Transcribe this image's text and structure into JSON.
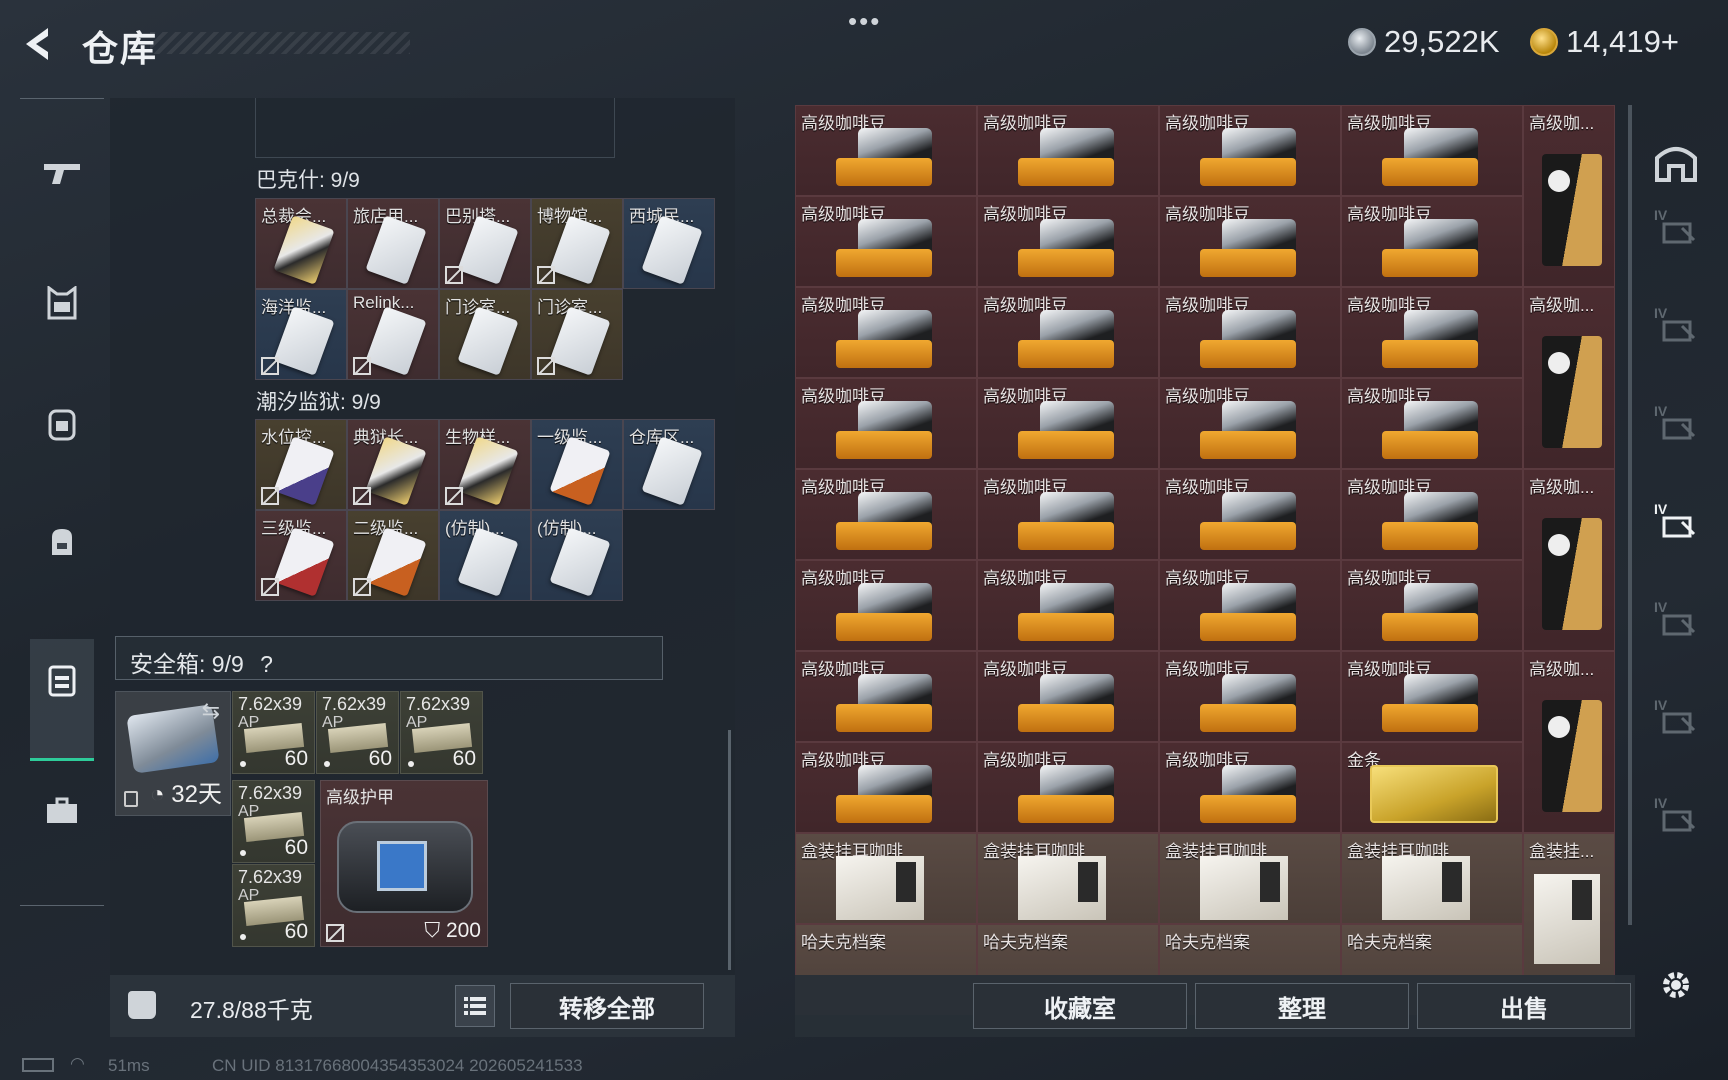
{
  "header": {
    "title": "仓库",
    "menu_dots": "•••",
    "currency_silver": "29,522K",
    "currency_gold": "14,419+",
    "colors": {
      "accent_green": "#2ecc9a",
      "item_red": "#4b2c30"
    }
  },
  "left_sidebar": {
    "icons": [
      "gun-icon",
      "armor-vest-icon",
      "backpack-icon",
      "bag-icon",
      "container-icon",
      "briefcase-icon"
    ],
    "active_index": 4
  },
  "keycards": {
    "groups": [
      {
        "title": "巴克什: 9/9",
        "cards": [
          {
            "label": "总裁会...",
            "style": "goldc",
            "color": "red",
            "bound": false
          },
          {
            "label": "旅店用...",
            "style": "",
            "color": "red",
            "bound": false
          },
          {
            "label": "巴别塔...",
            "style": "",
            "color": "red",
            "bound": true
          },
          {
            "label": "博物馆...",
            "style": "",
            "color": "gold",
            "bound": true
          },
          {
            "label": "西城民...",
            "style": "",
            "color": "blue",
            "bound": false
          },
          {
            "label": "海洋监...",
            "style": "",
            "color": "blue",
            "bound": true
          },
          {
            "label": "Relink...",
            "style": "",
            "color": "red",
            "bound": true
          },
          {
            "label": "门诊室...",
            "style": "",
            "color": "gold",
            "bound": false
          },
          {
            "label": "门诊室...",
            "style": "",
            "color": "gold",
            "bound": true
          }
        ]
      },
      {
        "title": "潮汐监狱: 9/9",
        "cards": [
          {
            "label": "水位控...",
            "style": "purple",
            "color": "gold",
            "bound": true
          },
          {
            "label": "典狱长...",
            "style": "goldc",
            "color": "red",
            "bound": true
          },
          {
            "label": "生物样...",
            "style": "goldc",
            "color": "red",
            "bound": true
          },
          {
            "label": "一级监...",
            "style": "orange",
            "color": "blue",
            "bound": false
          },
          {
            "label": "仓库区...",
            "style": "",
            "color": "blue",
            "bound": false
          },
          {
            "label": "三级监...",
            "style": "red",
            "color": "red",
            "bound": true
          },
          {
            "label": "二级监...",
            "style": "orange",
            "color": "gold",
            "bound": true
          },
          {
            "label": "(仿制)...",
            "style": "",
            "color": "blue",
            "bound": false
          },
          {
            "label": "(仿制)...",
            "style": "",
            "color": "blue",
            "bound": false
          }
        ]
      }
    ]
  },
  "safe_box": {
    "header": "安全箱:  9/9",
    "help": "?",
    "days": "32天",
    "ammo": [
      {
        "caliber": "7.62x39",
        "type": "AP",
        "count": "60"
      },
      {
        "caliber": "7.62x39",
        "type": "AP",
        "count": "60"
      },
      {
        "caliber": "7.62x39",
        "type": "AP",
        "count": "60"
      },
      {
        "caliber": "7.62x39",
        "type": "AP",
        "count": "60"
      },
      {
        "caliber": "7.62x39",
        "type": "AP",
        "count": "60"
      }
    ],
    "armor": {
      "label": "高级护甲",
      "value": "200"
    }
  },
  "weight": {
    "text": "27.8/88千克"
  },
  "transfer_all": "转移全部",
  "stash": {
    "coffee_label": "高级咖啡豆",
    "coffee_short": "高级咖...",
    "gold_label": "金条",
    "boxed_label": "盒装挂耳咖啡",
    "boxed_short": "盒装挂...",
    "havk_label": "哈夫克档案"
  },
  "right_buttons": [
    "收藏室",
    "整理",
    "出售"
  ],
  "right_sidebar": {
    "levels": [
      "IV",
      "IV",
      "IV",
      "IV",
      "IV",
      "IV",
      "IV"
    ],
    "active_index": 3
  },
  "status": {
    "ping": "51ms",
    "uid": "CN UID 8131766800435435302​4 2026052415​33"
  }
}
